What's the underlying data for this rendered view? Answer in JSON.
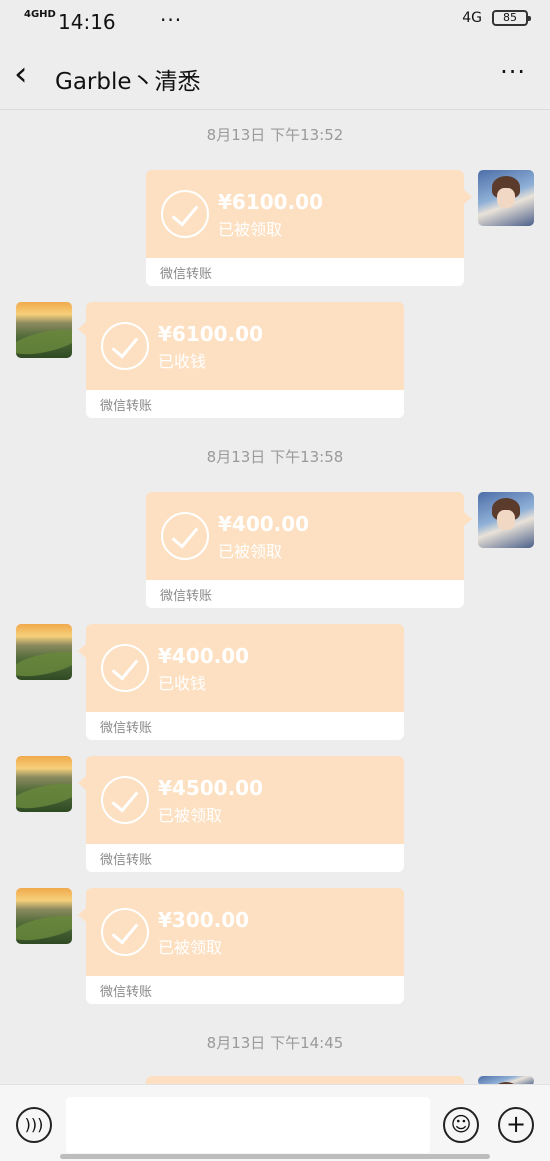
{
  "status_bar": {
    "signal": "4GHD",
    "time": "14:16",
    "dots": "···",
    "net": "4G",
    "battery": "85"
  },
  "nav": {
    "back_icon": "chevron-left-icon",
    "title": "Garble丶清悉",
    "more_icon": "more-icon"
  },
  "timestamps": [
    "8月13日 下午13:52",
    "8月13日 下午13:58",
    "8月13日 下午14:45"
  ],
  "messages": [
    {
      "side": "right",
      "amount": "¥6100.00",
      "status": "已被领取",
      "footer": "微信转账"
    },
    {
      "side": "left",
      "amount": "¥6100.00",
      "status": "已收钱",
      "footer": "微信转账"
    },
    {
      "side": "right",
      "amount": "¥400.00",
      "status": "已被领取",
      "footer": "微信转账"
    },
    {
      "side": "left",
      "amount": "¥400.00",
      "status": "已收钱",
      "footer": "微信转账"
    },
    {
      "side": "left",
      "amount": "¥4500.00",
      "status": "已被领取",
      "footer": "微信转账"
    },
    {
      "side": "left",
      "amount": "¥300.00",
      "status": "已被领取",
      "footer": "微信转账"
    }
  ],
  "input_bar": {
    "voice_icon": "voice-icon",
    "emoji_icon": "emoji-icon",
    "plus_icon": "plus-icon"
  },
  "colors": {
    "card_top": "#fde0c1",
    "background": "#ededed"
  }
}
